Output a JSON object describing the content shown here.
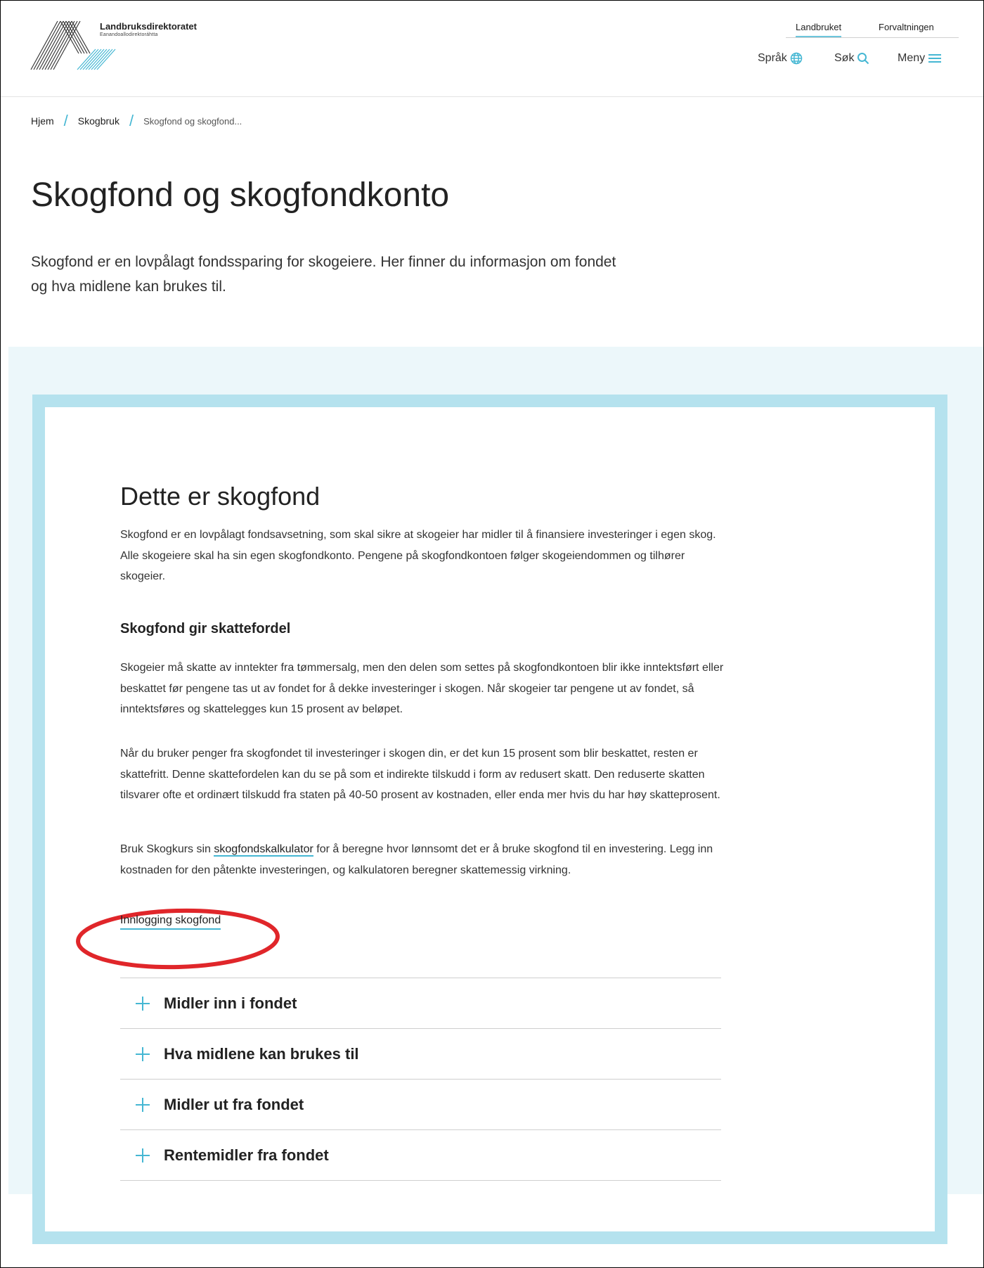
{
  "header": {
    "org_name": "Landbruksdirektoratet",
    "org_subtitle": "Eanandoallodirektoráhtta",
    "top_links": [
      "Landbruket",
      "Forvaltningen"
    ],
    "tools": {
      "language": "Språk",
      "search": "Søk",
      "menu": "Meny"
    },
    "icons": {
      "language": "globe-icon",
      "search": "search-icon",
      "menu": "hamburger-menu-icon"
    },
    "accent_color": "#45b7d3"
  },
  "breadcrumb": {
    "items": [
      "Hjem",
      "Skogbruk"
    ],
    "current": "Skogfond og skogfond..."
  },
  "page": {
    "title": "Skogfond og skogfondkonto",
    "lead": "Skogfond er en lovpålagt fondssparing for skogeiere. Her finner du informasjon om fondet og hva midlene kan brukes til."
  },
  "card": {
    "heading": "Dette er skogfond",
    "intro": "Skogfond er en lovpålagt fondsavsetning, som skal sikre at skogeier har midler til å finansiere investeringer i egen skog. Alle skogeiere skal ha sin egen skogfondkonto. Pengene på skogfondkontoen følger skogeiendommen og tilhører skogeier.",
    "subheading": "Skogfond gir skattefordel",
    "para1": "Skogeier må skatte av inntekter fra tømmersalg, men den delen som settes på skogfondkontoen blir ikke inntektsført eller beskattet før pengene tas ut av fondet for å dekke investeringer i skogen. Når skogeier tar pengene ut av fondet, så inntektsføres og skattelegges kun 15 prosent av beløpet.",
    "para2": "Når du bruker penger fra skogfondet til investeringer i skogen din, er det kun 15 prosent som blir beskattet, resten er skattefritt. Denne skattefordelen kan du se på som et indirekte tilskudd i form av redusert skatt. Den reduserte skatten tilsvarer ofte et ordinært tilskudd fra staten på 40-50 prosent av kostnaden, eller enda mer hvis du har høy skatteprosent.",
    "para3_before": "Bruk Skogkurs sin ",
    "para3_link": "skogfondskalkulator",
    "para3_after": " for å beregne hvor lønnsomt det er å bruke skogfond til en investering. Legg inn kostnaden for den påtenkte investeringen, og kalkulatoren beregner skattemessig virkning.",
    "login_link": "Innlogging skogfond",
    "highlight_color": "#e0262a"
  },
  "accordion": {
    "items": [
      "Midler inn i fondet",
      "Hva midlene kan brukes til",
      "Midler ut fra fondet",
      "Rentemidler fra fondet"
    ],
    "icon": "plus-icon"
  }
}
